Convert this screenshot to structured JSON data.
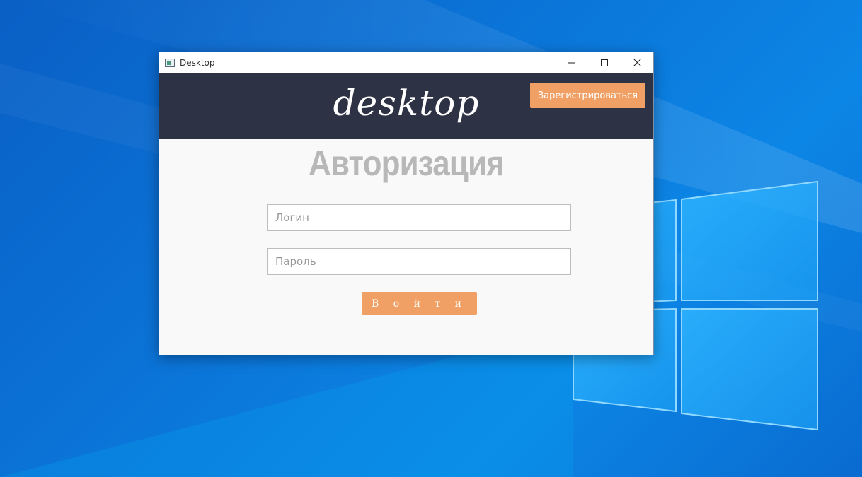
{
  "window": {
    "title": "Desktop"
  },
  "header": {
    "brand": "desktop",
    "register_label": "Зарегистрироваться"
  },
  "main": {
    "heading": "Авторизация",
    "login_placeholder": "Логин",
    "password_placeholder": "Пароль",
    "login_button_label": "В о й т и"
  },
  "colors": {
    "accent": "#f0a065",
    "header_bg": "#2e3245",
    "heading": "#b8b8b8",
    "desktop_bg": "#0b74d8"
  },
  "icons": {
    "app": "app-window-icon",
    "minimize": "minimize-icon",
    "maximize": "maximize-icon",
    "close": "close-icon"
  }
}
